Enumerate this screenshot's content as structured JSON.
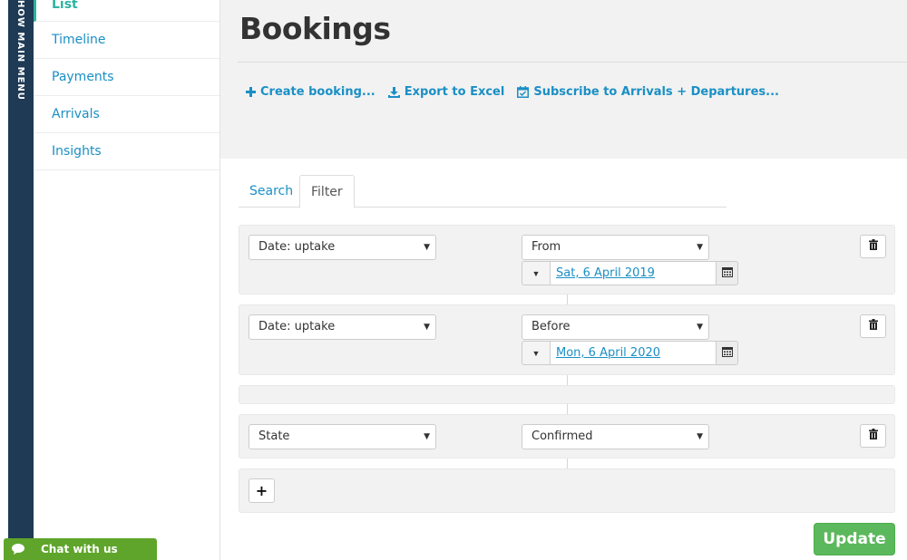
{
  "main_menu": {
    "label": "HOW MAIN MENU"
  },
  "subnav": {
    "items": [
      {
        "label": "List",
        "active": true
      },
      {
        "label": "Timeline"
      },
      {
        "label": "Payments"
      },
      {
        "label": "Arrivals"
      },
      {
        "label": "Insights"
      }
    ]
  },
  "header": {
    "title": "Bookings",
    "actions": [
      {
        "label": "Create booking...",
        "icon": "plus-icon"
      },
      {
        "label": "Export to Excel",
        "icon": "download-icon"
      },
      {
        "label": "Subscribe to Arrivals + Departures...",
        "icon": "calendar-check-icon"
      }
    ]
  },
  "tabs": [
    {
      "label": "Search"
    },
    {
      "label": "Filter",
      "active": true
    }
  ],
  "filters": [
    {
      "field": "Date: uptake",
      "operator": "From",
      "date": "Sat, 6 April 2019"
    },
    {
      "field": "Date: uptake",
      "operator": "Before",
      "date": "Mon, 6 April 2020"
    },
    {
      "field": "State",
      "operator": "Confirmed"
    }
  ],
  "add_button": {
    "label": "+"
  },
  "update_button": {
    "label": "Update"
  },
  "chat": {
    "label": "Chat with us"
  },
  "colors": {
    "accent_blue": "#1a8fc5",
    "active_teal": "#2db3a0",
    "update_green": "#5cb85c",
    "chat_green": "#5fa52b",
    "menu_navy": "#1e3a55"
  }
}
